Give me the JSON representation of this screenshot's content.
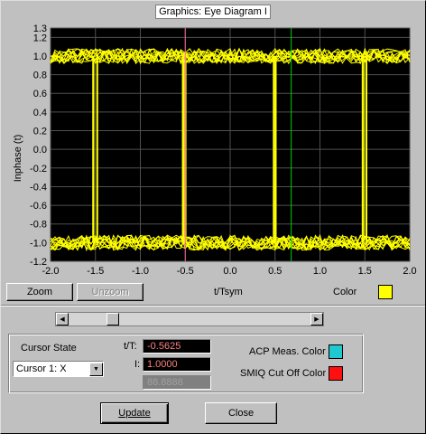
{
  "window": {
    "title": "Graphics: Eye Diagram I"
  },
  "chart_data": {
    "type": "line",
    "title": "",
    "xlabel": "t/Tsym",
    "ylabel": "Inphase (t)",
    "xlim": [
      -2.0,
      2.0
    ],
    "ylim": [
      -1.2,
      1.3
    ],
    "x_ticks": [
      "-2.0",
      "-1.5",
      "-1.0",
      "-0.5",
      "0.0",
      "0.5",
      "1.0",
      "1.5",
      "2.0"
    ],
    "y_ticks": [
      "1.3",
      "1.2",
      "1.0",
      "0.8",
      "0.6",
      "0.4",
      "0.2",
      "0.0",
      "-0.2",
      "-0.4",
      "-0.6",
      "-0.8",
      "-1.0",
      "-1.2"
    ],
    "levels": [
      1.0,
      -1.0
    ],
    "transitions_x": [
      -1.5,
      -0.5,
      0.5,
      1.5
    ],
    "trace_color": "#ffff00",
    "background": "#000000",
    "grid": true,
    "cursors": [
      {
        "x": -0.5,
        "color": "#ff60a0"
      },
      {
        "x": 0.68,
        "color": "#00d000"
      }
    ]
  },
  "plot_buttons": {
    "zoom": "Zoom",
    "unzoom": "Unzoom"
  },
  "color": {
    "label": "Color",
    "value": "#ffff00"
  },
  "cursor": {
    "state_label": "Cursor State",
    "selected": "Cursor 1: X",
    "t_label": "t/T:",
    "t_value": "-0.5625",
    "i_label": "I:",
    "i_value": "1.0000",
    "third_value": "88.8888"
  },
  "acp": {
    "label": "ACP Meas. Color",
    "color": "#20c8d0"
  },
  "smiq": {
    "label": "SMIQ Cut Off Color",
    "color": "#ff1010"
  },
  "buttons": {
    "update": "Update",
    "close": "Close"
  }
}
